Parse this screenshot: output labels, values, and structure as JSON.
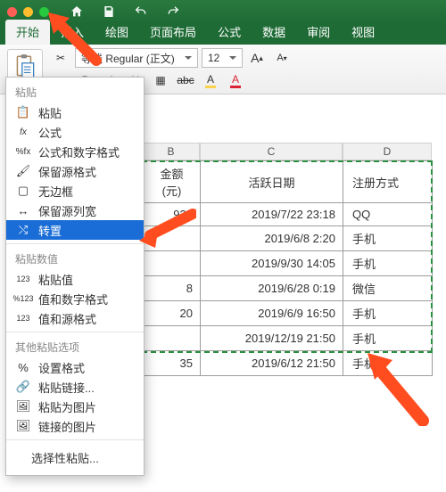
{
  "titlebar": {
    "icons": [
      "home",
      "save",
      "undo",
      "redo"
    ]
  },
  "ribbon": {
    "tabs": [
      "开始",
      "插入",
      "绘图",
      "页面布局",
      "公式",
      "数据",
      "审阅",
      "视图"
    ],
    "active_tab": "开始",
    "font_name": "等线 Regular (正文)",
    "font_size": "12"
  },
  "dropdown": {
    "section_paste": "粘贴",
    "items_paste": [
      "粘贴",
      "公式",
      "公式和数字格式",
      "保留源格式",
      "无边框",
      "保留源列宽",
      "转置"
    ],
    "selected": "转置",
    "section_values": "粘贴数值",
    "items_values": [
      "粘贴值",
      "值和数字格式",
      "值和源格式"
    ],
    "section_other": "其他粘贴选项",
    "items_other": [
      "设置格式",
      "粘贴链接...",
      "粘贴为图片",
      "链接的图片"
    ],
    "footer": "选择性粘贴..."
  },
  "grid": {
    "col_letters": [
      "B",
      "C",
      "D"
    ],
    "headers": [
      "金额(元)",
      "活跃日期",
      "注册方式"
    ],
    "rows": [
      {
        "b": "921",
        "c": "2019/7/22 23:18",
        "d": "QQ"
      },
      {
        "b": "",
        "c": "2019/6/8 2:20",
        "d": "手机"
      },
      {
        "b": "",
        "c": "2019/9/30 14:05",
        "d": "手机"
      },
      {
        "b": "8",
        "c": "2019/6/28 0:19",
        "d": "微信"
      },
      {
        "b": "20",
        "c": "2019/6/9 16:50",
        "d": "手机"
      },
      {
        "b": "",
        "c": "2019/12/19 21:50",
        "d": "手机"
      },
      {
        "b": "35",
        "c": "2019/6/12 21:50",
        "d": "手机"
      }
    ]
  },
  "chart_data": {
    "type": "table",
    "headers": [
      "金额(元)",
      "活跃日期",
      "注册方式"
    ],
    "rows": [
      [
        "921",
        "2019/7/22 23:18",
        "QQ"
      ],
      [
        "",
        "2019/6/8 2:20",
        "手机"
      ],
      [
        "",
        "2019/9/30 14:05",
        "手机"
      ],
      [
        "8",
        "2019/6/28 0:19",
        "微信"
      ],
      [
        "20",
        "2019/6/9 16:50",
        "手机"
      ],
      [
        "",
        "2019/12/19 21:50",
        "手机"
      ],
      [
        "35",
        "2019/6/12 21:50",
        "手机"
      ]
    ]
  }
}
